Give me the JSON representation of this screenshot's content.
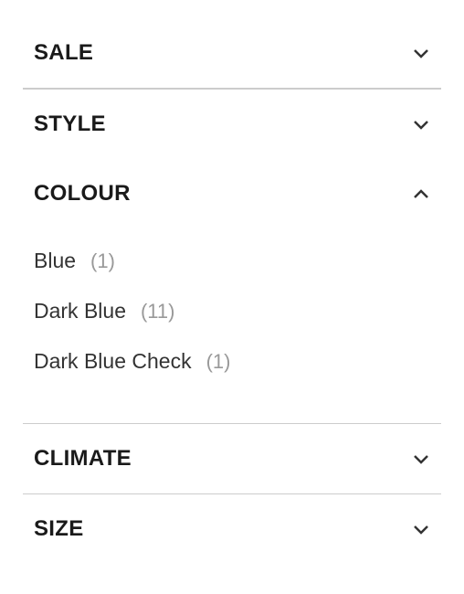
{
  "filters": {
    "sale": {
      "title": "SALE",
      "expanded": false
    },
    "style": {
      "title": "STYLE",
      "expanded": false
    },
    "colour": {
      "title": "COLOUR",
      "expanded": true,
      "options": [
        {
          "label": "Blue",
          "count": "(1)"
        },
        {
          "label": "Dark Blue",
          "count": "(11)"
        },
        {
          "label": "Dark Blue Check",
          "count": "(1)"
        }
      ]
    },
    "climate": {
      "title": "CLIMATE",
      "expanded": false
    },
    "size": {
      "title": "SIZE",
      "expanded": false
    }
  }
}
